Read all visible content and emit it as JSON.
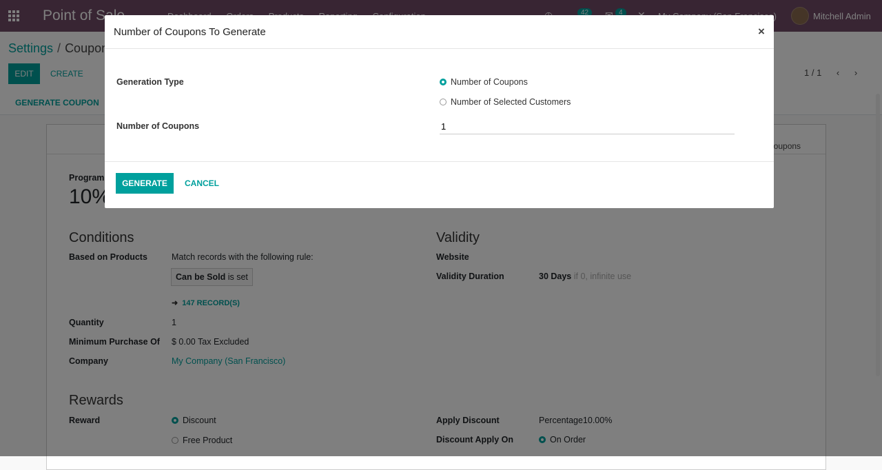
{
  "navbar": {
    "brand": "Point of Sale",
    "menu": [
      "Dashboard",
      "Orders",
      "Products",
      "Reporting",
      "Configuration"
    ],
    "activity_count": "42",
    "message_count": "4",
    "company": "My Company (San Francisco)",
    "user": "Mitchell Admin"
  },
  "control_panel": {
    "breadcrumb_root": "Settings",
    "breadcrumb_current": "Coupon",
    "edit_label": "EDIT",
    "create_label": "CREATE",
    "pager": "1 / 1",
    "generate_coupon_label": "GENERATE COUPON"
  },
  "form": {
    "smart_button": "Coupons",
    "program_label": "Program",
    "program_value": "10%",
    "conditions_heading": "Conditions",
    "based_on_products_label": "Based on Products",
    "rule_text": "Match records with the following rule:",
    "rule_field": "Can be Sold",
    "rule_op": "is set",
    "records_link": "147 RECORD(S)",
    "quantity_label": "Quantity",
    "quantity_value": "1",
    "min_purchase_label": "Minimum Purchase Of",
    "min_purchase_value": "$ 0.00",
    "min_purchase_tax": "Tax Excluded",
    "company_label": "Company",
    "company_value": "My Company (San Francisco)",
    "validity_heading": "Validity",
    "website_label": "Website",
    "validity_duration_label": "Validity Duration",
    "validity_duration_value": "30 Days",
    "validity_hint": "if 0, infinite use",
    "rewards_heading": "Rewards",
    "reward_label": "Reward",
    "reward_options": [
      "Discount",
      "Free Product"
    ],
    "apply_discount_label": "Apply Discount",
    "apply_discount_value": "Percentage10.00%",
    "discount_apply_on_label": "Discount Apply On",
    "discount_apply_on_value": "On Order"
  },
  "modal": {
    "title": "Number of Coupons To Generate",
    "close_glyph": "×",
    "generation_type_label": "Generation Type",
    "option_number_of_coupons": "Number of Coupons",
    "option_selected_customers": "Number of Selected Customers",
    "number_of_coupons_label": "Number of Coupons",
    "number_of_coupons_value": "1",
    "generate_label": "GENERATE",
    "cancel_label": "CANCEL"
  },
  "colors": {
    "brand": "#714B67",
    "accent": "#00A09D"
  },
  "icons": {
    "apps": "grid-icon",
    "activity": "clock-icon",
    "messages": "chat-icon",
    "debug": "bug-icon",
    "pager_prev": "chevron-left-icon",
    "pager_next": "chevron-right-icon",
    "records_arrow": "arrow-right-icon"
  }
}
